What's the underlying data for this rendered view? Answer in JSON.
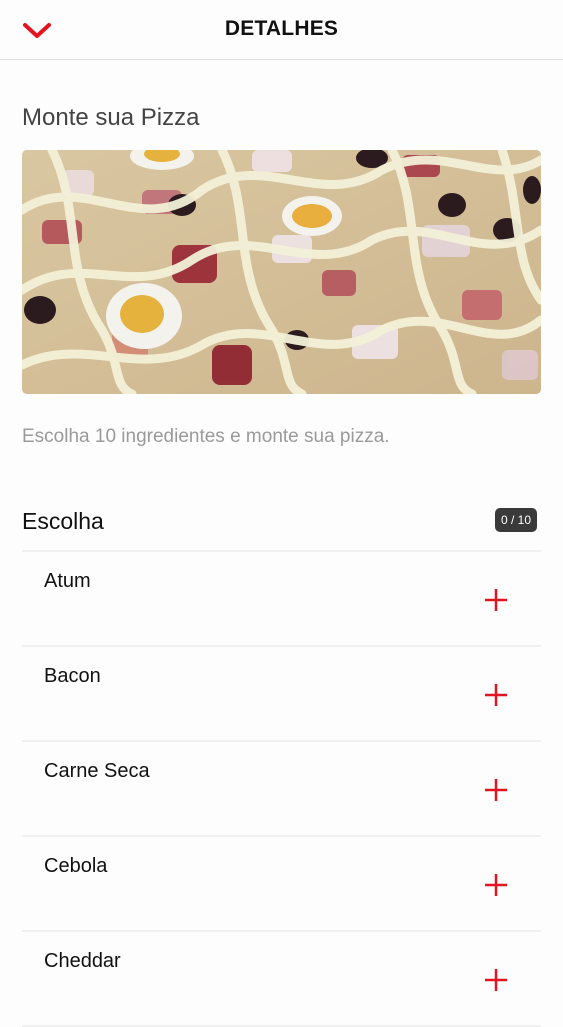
{
  "header": {
    "title": "DETALHES",
    "back_icon": "chevron-down-icon",
    "accent_color": "#e3141f"
  },
  "product": {
    "title": "Monte sua Pizza",
    "description": "Escolha 10 ingredientes e monte sua pizza."
  },
  "section": {
    "title": "Escolha",
    "counter": "0 / 10"
  },
  "ingredients": [
    {
      "name": "Atum",
      "action_icon": "plus-icon"
    },
    {
      "name": "Bacon",
      "action_icon": "plus-icon"
    },
    {
      "name": "Carne Seca",
      "action_icon": "plus-icon"
    },
    {
      "name": "Cebola",
      "action_icon": "plus-icon"
    },
    {
      "name": "Cheddar",
      "action_icon": "plus-icon"
    }
  ]
}
